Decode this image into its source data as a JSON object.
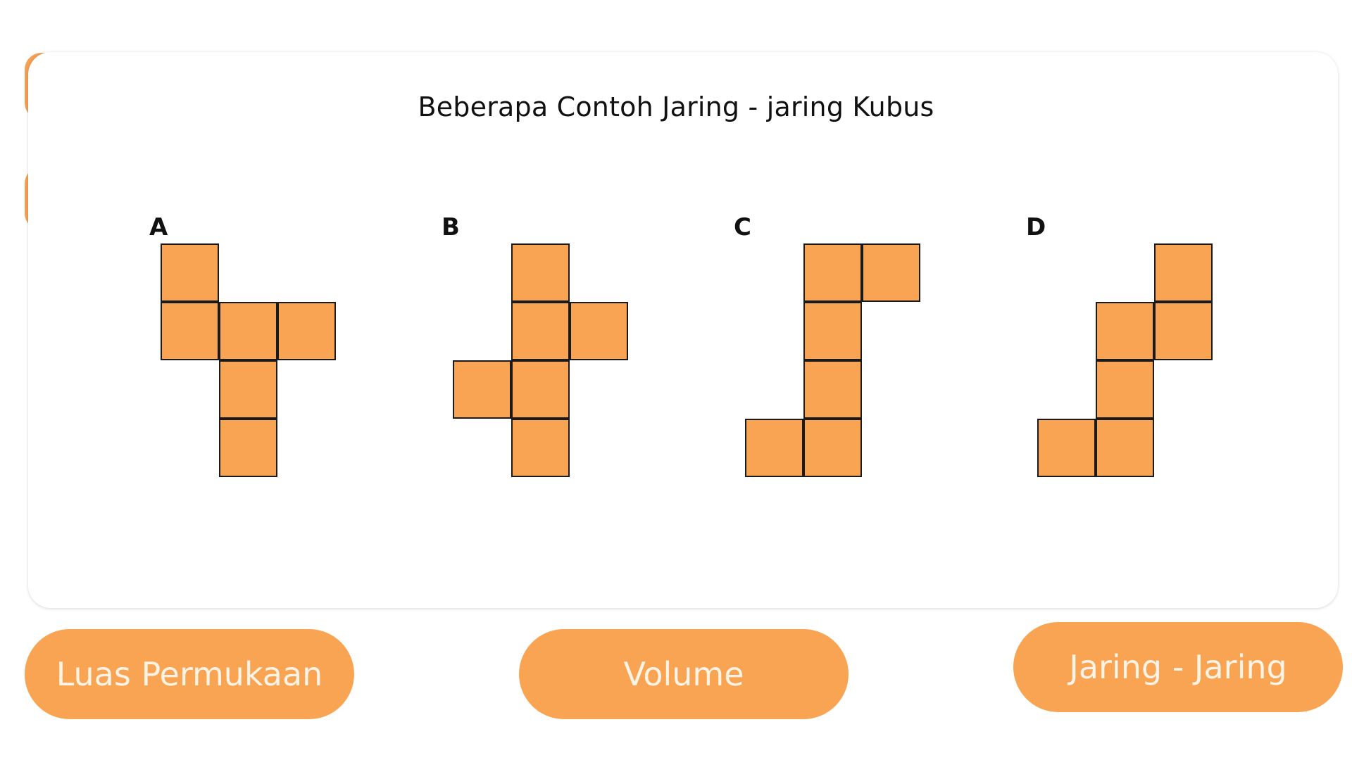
{
  "page": {
    "title": "Beberapa Contoh Jaring - jaring  Kubus"
  },
  "colors": {
    "accent": "#f8a452",
    "card_background": "#ffffff",
    "outline": "#1a1a1a",
    "button_text": "#fff3e6"
  },
  "nets": [
    {
      "label": "A",
      "rows": [
        "X..",
        "XXX",
        ".X.",
        ".X."
      ]
    },
    {
      "label": "B",
      "rows": [
        ".X.",
        ".XX",
        "XX.",
        ".X."
      ]
    },
    {
      "label": "C",
      "rows": [
        ".XX",
        ".X.",
        ".X.",
        "XX."
      ]
    },
    {
      "label": "D",
      "rows": [
        "..X",
        ".XX",
        ".X.",
        "XX."
      ]
    }
  ],
  "nav": {
    "luas_label": "Luas Permukaan",
    "volume_label": "Volume",
    "jaring_label": "Jaring - Jaring"
  }
}
